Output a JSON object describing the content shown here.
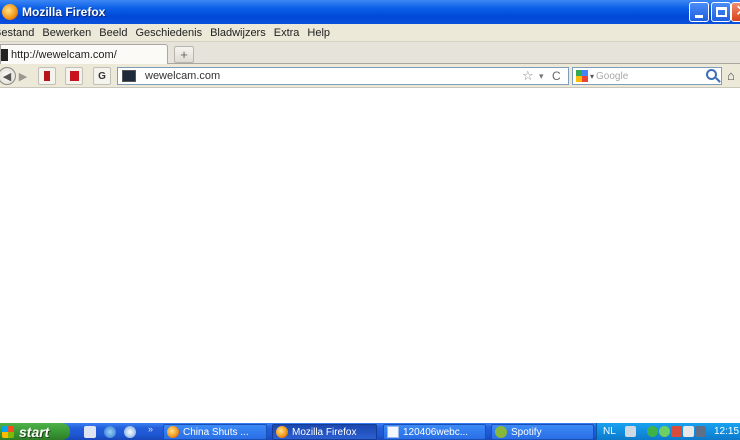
{
  "window": {
    "title": "Mozilla Firefox",
    "minimize_label": "",
    "maximize_label": "",
    "close_glyph": "✕"
  },
  "menubar": {
    "items": [
      "Bestand",
      "Bewerken",
      "Beeld",
      "Geschiedenis",
      "Bladwijzers",
      "Extra",
      "Help"
    ]
  },
  "tabs": [
    {
      "title": "http://wewelcam.com/",
      "active": true
    }
  ],
  "new_tab_label": "+",
  "navbar": {
    "back_glyph": "◀",
    "forward_glyph": "▶",
    "url": "wewelcam.com",
    "star_glyph": "☆",
    "dropmarker_glyph": "▾",
    "reload_glyph": "C",
    "ext3_glyph": "G",
    "search_engine": "Google",
    "search_placeholder": "Google",
    "engine_drop_glyph": "▾",
    "home_glyph": "⌂"
  },
  "taskbar": {
    "start_label": "start",
    "more_glyph": "»",
    "buttons": [
      {
        "label": "China Shuts ...",
        "icon": "firefox-icon",
        "active": false
      },
      {
        "label": "Mozilla Firefox",
        "icon": "firefox-icon",
        "active": true
      },
      {
        "label": "120406webc...",
        "icon": "document-icon",
        "active": false
      },
      {
        "label": "Spotify",
        "icon": "spotify-icon",
        "active": false
      }
    ],
    "language": "NL",
    "clock": "12:15"
  },
  "colors": {
    "titlebar": "#0148d6",
    "chrome": "#ece9d8",
    "taskbar": "#245edb",
    "start": "#3a9a35",
    "tray": "#118ee0"
  }
}
